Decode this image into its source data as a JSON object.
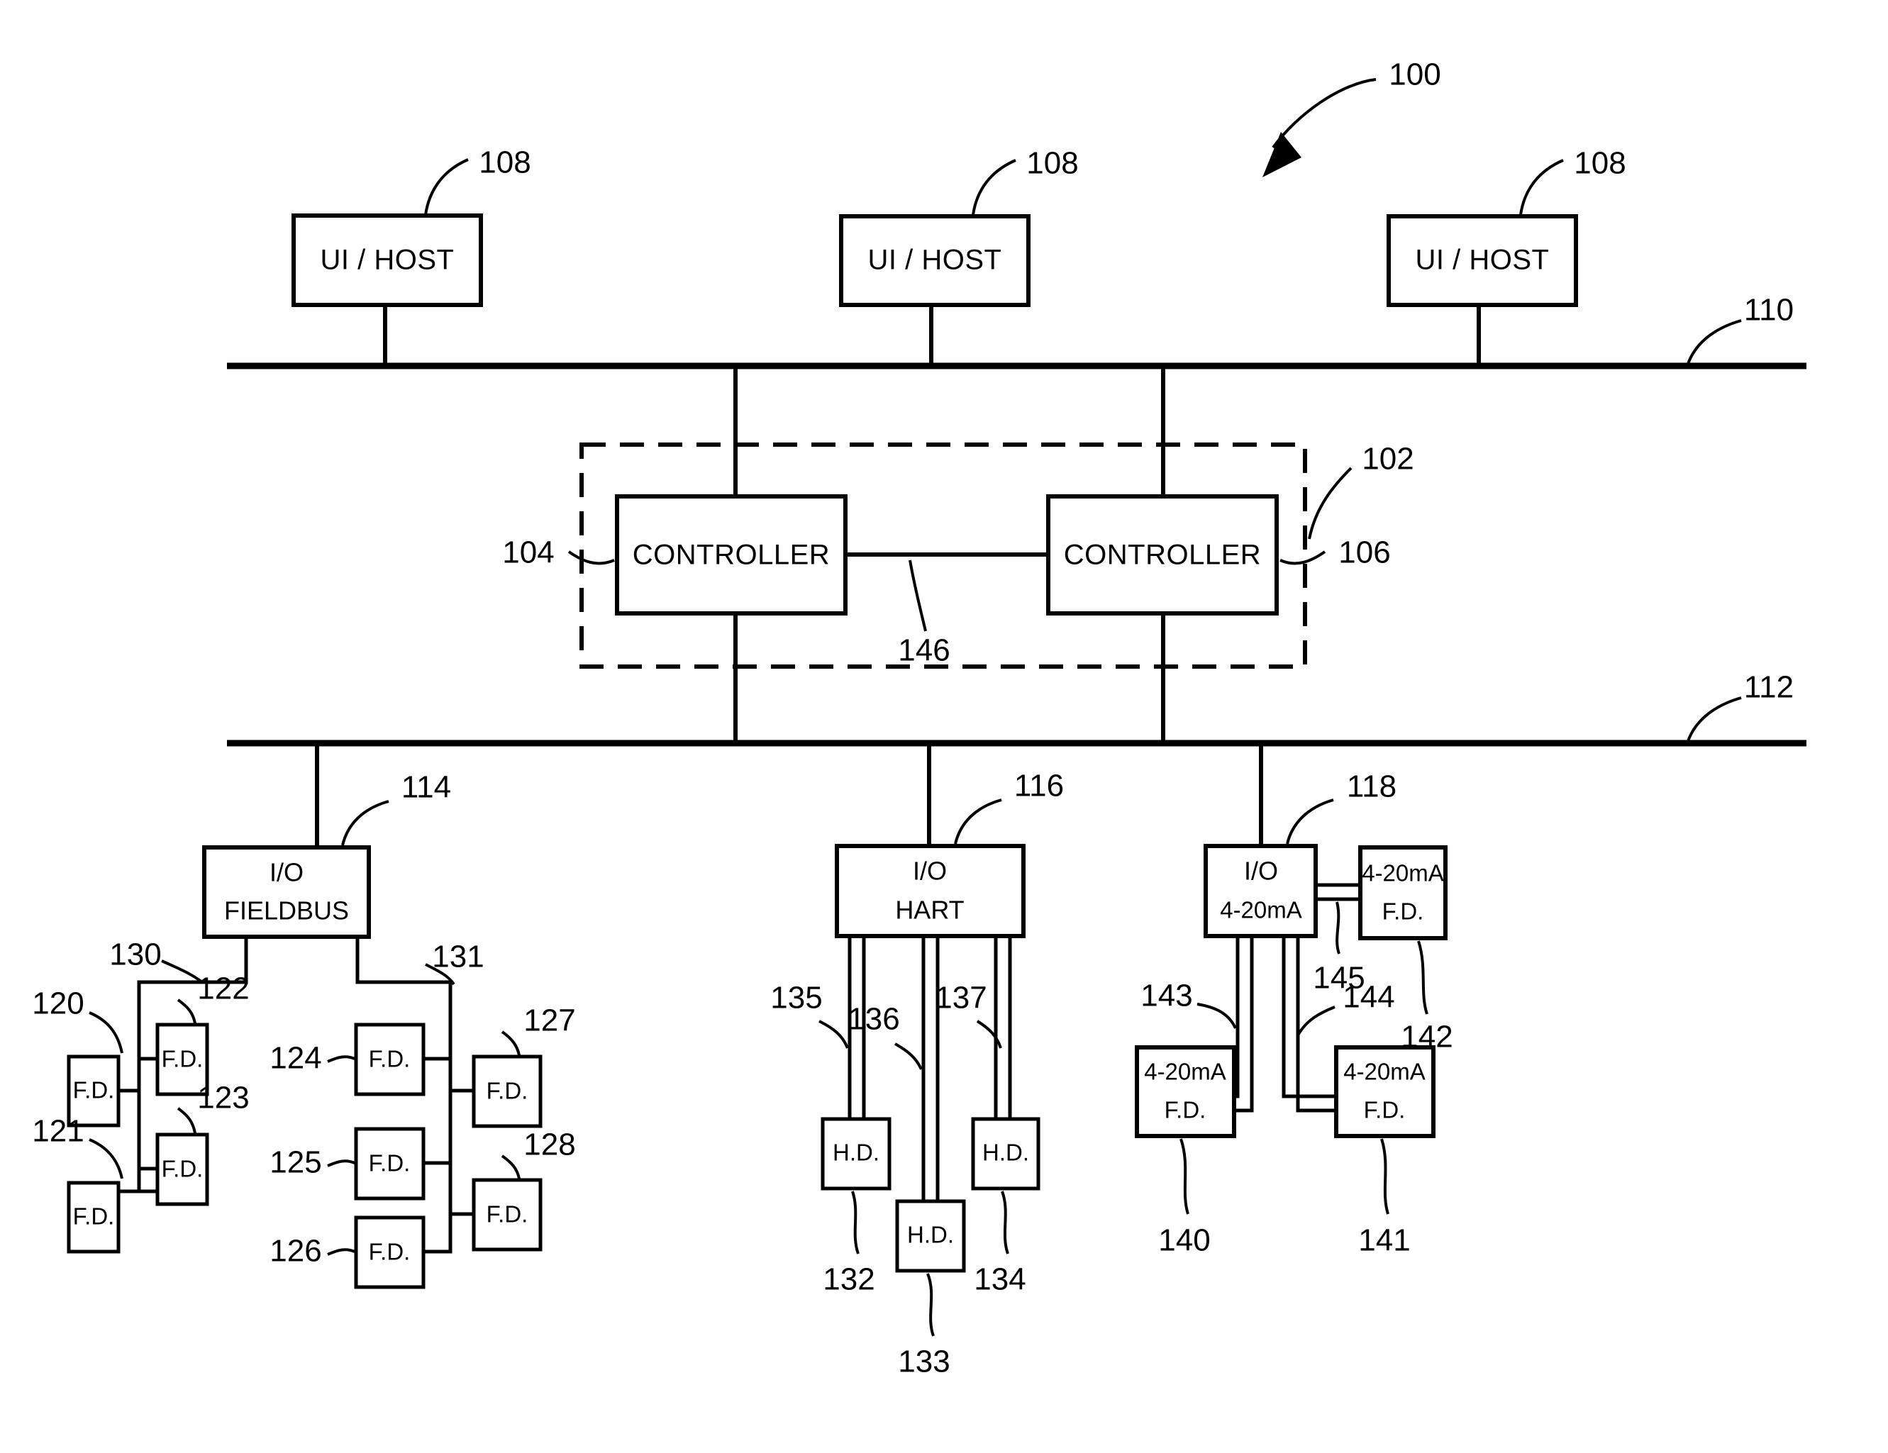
{
  "figure": {
    "title": "100",
    "arrow_label": "100"
  },
  "nodes": {
    "ui_hosts": [
      {
        "label": "UI / HOST",
        "ref": "108"
      },
      {
        "label": "UI / HOST",
        "ref": "108"
      },
      {
        "label": "UI / HOST",
        "ref": "108"
      }
    ],
    "controller_group": {
      "ref": "102",
      "left": {
        "label": "CONTROLLER",
        "ref": "104"
      },
      "right": {
        "label": "CONTROLLER",
        "ref": "106"
      },
      "link_ref": "146"
    },
    "buses": {
      "upper": {
        "ref": "110"
      },
      "lower": {
        "ref": "112"
      }
    },
    "io_modules": [
      {
        "line1": "I/O",
        "line2": "FIELDBUS",
        "ref": "114"
      },
      {
        "line1": "I/O",
        "line2": "HART",
        "ref": "116"
      },
      {
        "line1": "I/O",
        "line2": "4-20mA",
        "ref": "118"
      }
    ],
    "fieldbus_segments": [
      {
        "ref": "130"
      },
      {
        "ref": "131"
      }
    ],
    "fieldbus_devices": [
      {
        "label": "F.D.",
        "ref": "120"
      },
      {
        "label": "F.D.",
        "ref": "121"
      },
      {
        "label": "F.D.",
        "ref": "122"
      },
      {
        "label": "F.D.",
        "ref": "123"
      },
      {
        "label": "F.D.",
        "ref": "124"
      },
      {
        "label": "F.D.",
        "ref": "125"
      },
      {
        "label": "F.D.",
        "ref": "126"
      },
      {
        "label": "F.D.",
        "ref": "127"
      },
      {
        "label": "F.D.",
        "ref": "128"
      }
    ],
    "hart_devices": [
      {
        "label": "H.D.",
        "ref": "132",
        "link_ref": "135"
      },
      {
        "label": "H.D.",
        "ref": "133",
        "link_ref": "136"
      },
      {
        "label": "H.D.",
        "ref": "134",
        "link_ref": "137"
      }
    ],
    "analog_devices": [
      {
        "line1": "4-20mA",
        "line2": "F.D.",
        "ref": "140",
        "link_ref": "143"
      },
      {
        "line1": "4-20mA",
        "line2": "F.D.",
        "ref": "141",
        "link_ref": "144"
      },
      {
        "line1": "4-20mA",
        "line2": "F.D.",
        "ref": "142",
        "link_ref": "145"
      }
    ]
  },
  "colors": {
    "ink": "#000000",
    "paper": "#ffffff"
  }
}
